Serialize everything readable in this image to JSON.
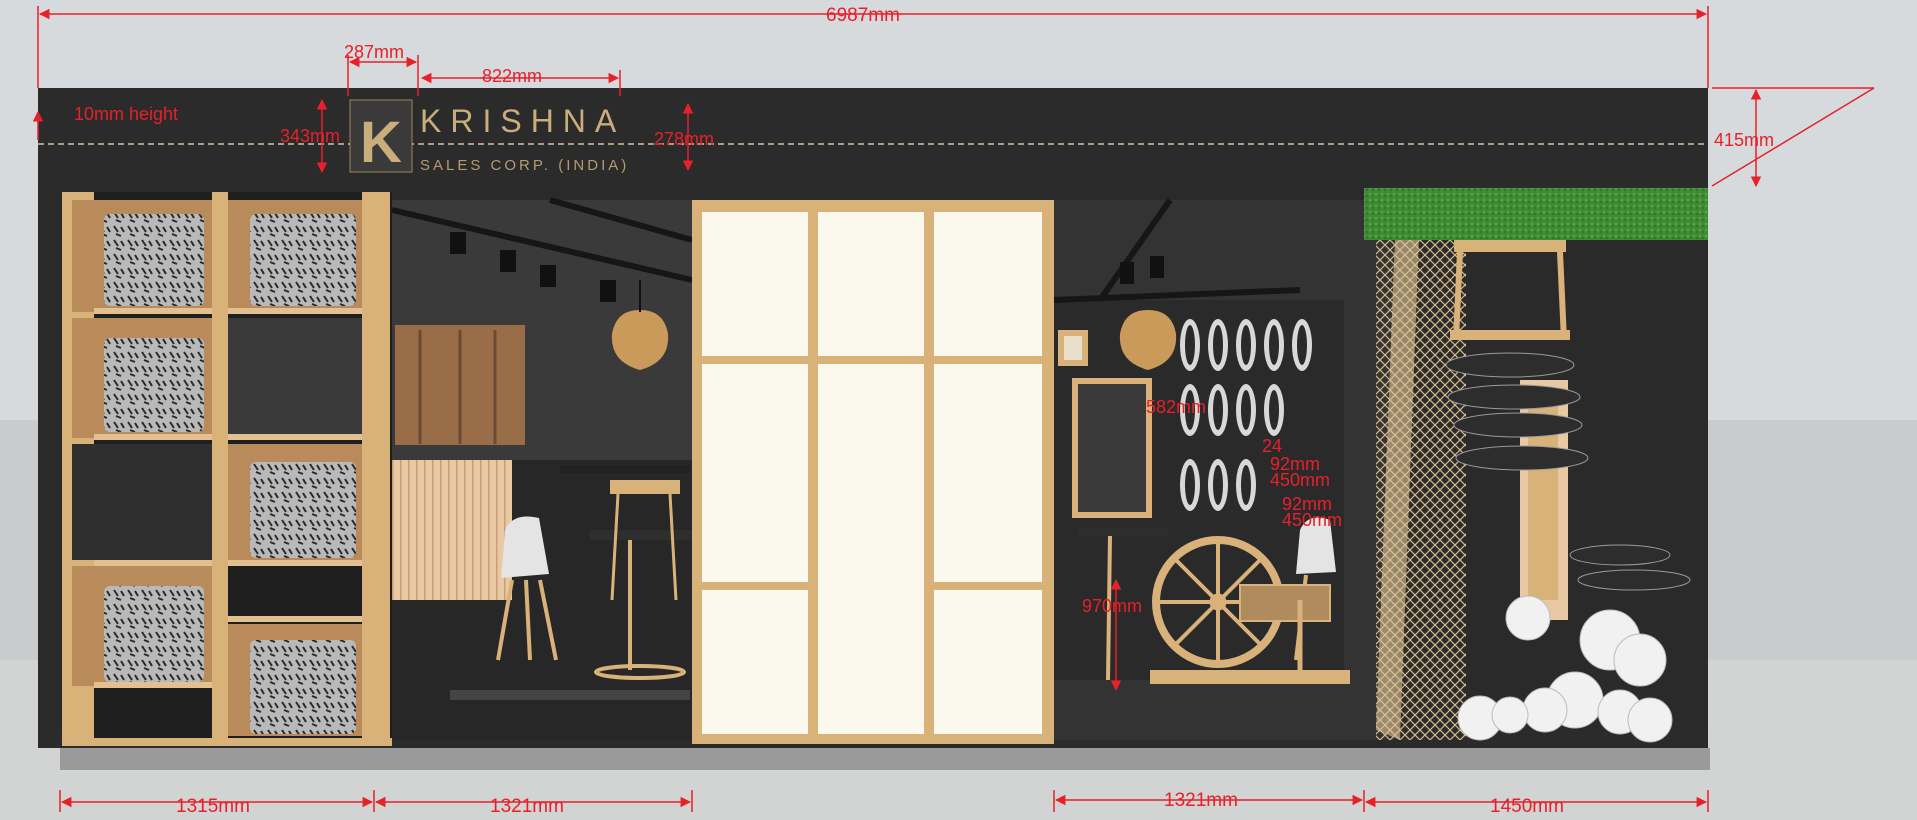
{
  "brand": {
    "logo_letter": "K",
    "name": "KRISHNA",
    "tagline": "SALES CORP. (INDIA)"
  },
  "dimensions": {
    "overall_width": "6987mm",
    "logo_width": "287mm",
    "name_width": "822mm",
    "sign_height_note": "10mm height",
    "logo_height": "343mm",
    "name_height": "278mm",
    "fascia_height": "415mm",
    "bottom_1": "1315mm",
    "bottom_2": "1321mm",
    "bottom_3": "1321mm",
    "bottom_4": "1450mm",
    "table_height": "970mm",
    "rack_height": "582mm",
    "shelf_a": "24",
    "shelf_b": "92mm",
    "shelf_c": "450mm",
    "shelf_d": "92mm",
    "shelf_e": "450mm"
  },
  "colors": {
    "dimension": "#e8202a",
    "fascia": "#2b2b2b",
    "wood": "#d9b27a",
    "floor": "#2e2e2e",
    "grass": "#3f8a34"
  }
}
